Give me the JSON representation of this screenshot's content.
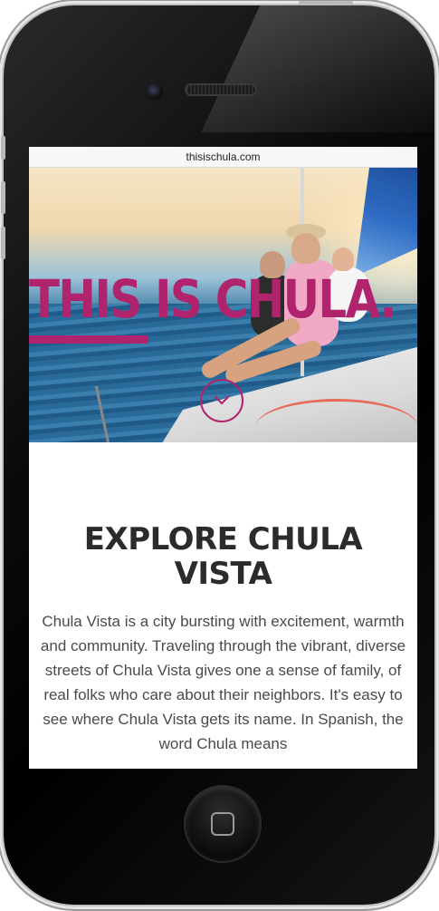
{
  "browser": {
    "url": "thisischula.com"
  },
  "hero": {
    "headline": "THIS IS CHULA.",
    "scroll_icon": "chevron-down-icon"
  },
  "intro": {
    "title": "EXPLORE CHULA VISTA",
    "body": "Chula Vista is a city bursting with excitement, warmth and community. Traveling through the vibrant, diverse streets of Chula Vista gives one a sense of family, of real folks who care about their neighbors. It's easy to see where Chula Vista gets its name. In Spanish, the word Chula means"
  },
  "colors": {
    "brand": "#b0246d",
    "heading": "#2b2b2b",
    "body_text": "#4a4a4a"
  }
}
